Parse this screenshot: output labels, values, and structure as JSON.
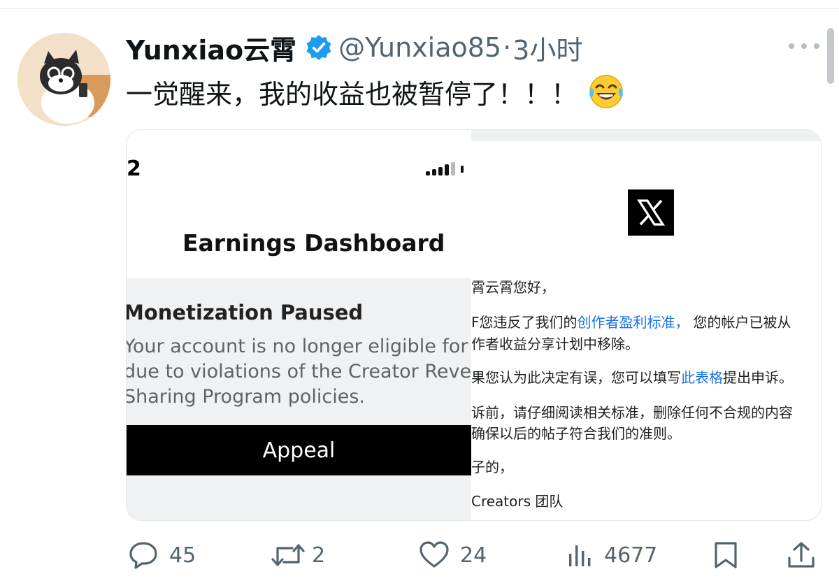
{
  "tweet": {
    "display_name": "Yunxiao云霄",
    "handle": "@Yunxiao85",
    "separator": "·",
    "time": "3小时",
    "text": "一觉醒来，我的收益也被暂停了！！！",
    "emoji": "face-with-tears-of-joy"
  },
  "media": {
    "left": {
      "status_number": "2",
      "title": "Earnings Dashboard",
      "paused_title": "Monetization Paused",
      "paused_lines": [
        "Your account is no longer eligible for pa",
        "due to violations of the Creator Revenu",
        "Sharing Program policies."
      ],
      "appeal_label": "Appeal"
    },
    "right": {
      "greeting": "霄云霄您好，",
      "p1_before": "F您违反了我们的",
      "p1_link": "创作者盈利标准，",
      "p1_after": "您的帐户已被从",
      "p1_line2": "作者收益分享计划中移除。",
      "p2_before": "果您认为此决定有误，您可以填写",
      "p2_link": "此表格",
      "p2_after": "提出申诉。",
      "p3_line1": "诉前，请仔细阅读相关标准，删除任何不合规的内容",
      "p3_line2": "确保以后的帖子符合我们的准则。",
      "closing": "子的，",
      "signature": "Creators 团队"
    }
  },
  "actions": {
    "replies": "45",
    "reposts": "2",
    "likes": "24",
    "views": "4677"
  },
  "colors": {
    "verified_blue": "#1d9bf0",
    "secondary_text": "#536471",
    "link_blue": "#1a73e8"
  }
}
